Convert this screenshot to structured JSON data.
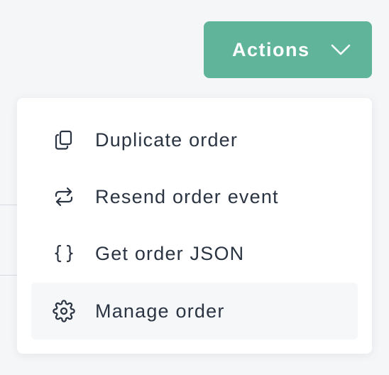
{
  "actions_button": {
    "label": "Actions",
    "icon": "chevron-down-icon",
    "color": "#60b499"
  },
  "menu": {
    "items": [
      {
        "label": "Duplicate order",
        "icon": "copy-icon"
      },
      {
        "label": "Resend order event",
        "icon": "repeat-icon"
      },
      {
        "label": "Get order JSON",
        "icon": "braces-icon"
      },
      {
        "label": "Manage order",
        "icon": "gear-icon",
        "highlighted": true
      }
    ]
  },
  "colors": {
    "page_background": "#f5f6f8",
    "menu_background": "#ffffff",
    "highlight_background": "#f6f7f9",
    "text": "#2b3442"
  }
}
